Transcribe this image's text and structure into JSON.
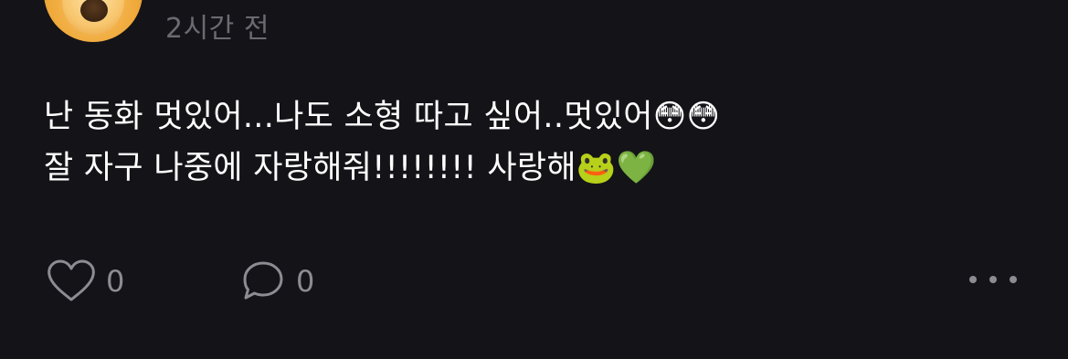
{
  "post": {
    "timestamp": "2시간 전",
    "text_line1": "난 동화 멋있어...나도 소형 따고 싶어..멋있어😳😳",
    "text_line2": "잘 자구 나중에 자랑해줘!!!!!!!! 사랑해🐸💚"
  },
  "actions": {
    "like_icon": "heart-outline-icon",
    "like_count": "0",
    "comment_icon": "speech-bubble-icon",
    "comment_count": "0",
    "more_icon": "more-horizontal-icon"
  },
  "colors": {
    "background": "#141318",
    "text": "#ffffff",
    "muted": "#6b6a70",
    "icon": "#8d8c92"
  }
}
